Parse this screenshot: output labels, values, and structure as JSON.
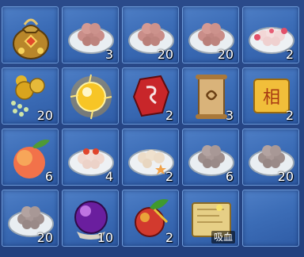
{
  "inventory": {
    "slots": [
      {
        "item": "money-pouch-icon",
        "count": ""
      },
      {
        "item": "meatball-plate-icon",
        "count": "3"
      },
      {
        "item": "meatball-plate-icon",
        "count": "20"
      },
      {
        "item": "meatball-plate-icon",
        "count": "20"
      },
      {
        "item": "rose-dumpling-plate-icon",
        "count": "2"
      },
      {
        "item": "gourd-beads-icon",
        "count": "20"
      },
      {
        "item": "glowing-orb-icon",
        "count": ""
      },
      {
        "item": "red-rune-stone-icon",
        "count": "2"
      },
      {
        "item": "rune-scroll-icon",
        "count": "3"
      },
      {
        "item": "golden-plaque-icon",
        "count": "2",
        "text": "相"
      },
      {
        "item": "peach-icon",
        "count": "6"
      },
      {
        "item": "tomato-dumpling-plate-icon",
        "count": "4"
      },
      {
        "item": "starfish-dumpling-plate-icon",
        "count": "2"
      },
      {
        "item": "pearl-plate-icon",
        "count": "6"
      },
      {
        "item": "pearl-plate-icon",
        "count": "20"
      },
      {
        "item": "pearl-plate-icon",
        "count": "20"
      },
      {
        "item": "purple-orb-icon",
        "count": "10"
      },
      {
        "item": "magic-fruit-icon",
        "count": "2"
      },
      {
        "item": "treasure-map-icon",
        "count": "",
        "label": "吸血"
      },
      {
        "item": "empty-slot",
        "count": ""
      }
    ]
  },
  "colors": {
    "slot_bg": "#3c6db7",
    "slot_border": "#6c99d8",
    "count_text": "#ffffff"
  }
}
